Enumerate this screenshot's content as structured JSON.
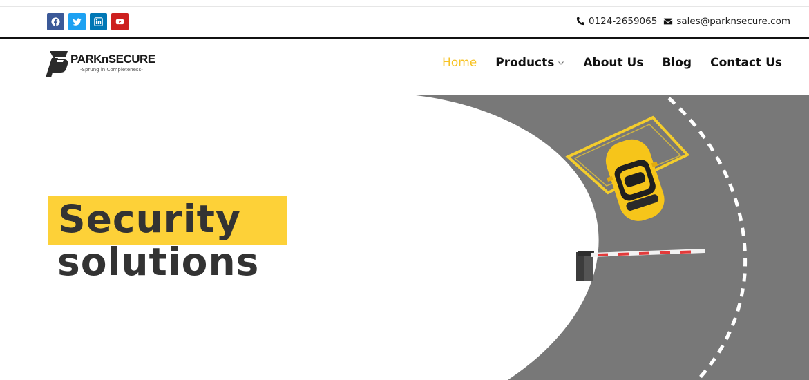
{
  "social": {
    "items": [
      {
        "name": "facebook",
        "color": "#3b5998"
      },
      {
        "name": "twitter",
        "color": "#1da1f2"
      },
      {
        "name": "linkedin",
        "color": "#0077b5"
      },
      {
        "name": "youtube",
        "color": "#cd201f"
      }
    ]
  },
  "contact": {
    "phone": "0124-2659065",
    "email": "sales@parknsecure.com"
  },
  "logo": {
    "text": "PARKnSECURE",
    "tagline": "-Sprung in Completeness-"
  },
  "nav": {
    "home": "Home",
    "products": "Products",
    "about": "About Us",
    "blog": "Blog",
    "contact": "Contact Us"
  },
  "hero": {
    "line1": "Security",
    "line2": "solutions"
  },
  "colors": {
    "accent": "#f7c325",
    "highlight": "#fdd138",
    "road": "#787878",
    "text": "#333333"
  }
}
